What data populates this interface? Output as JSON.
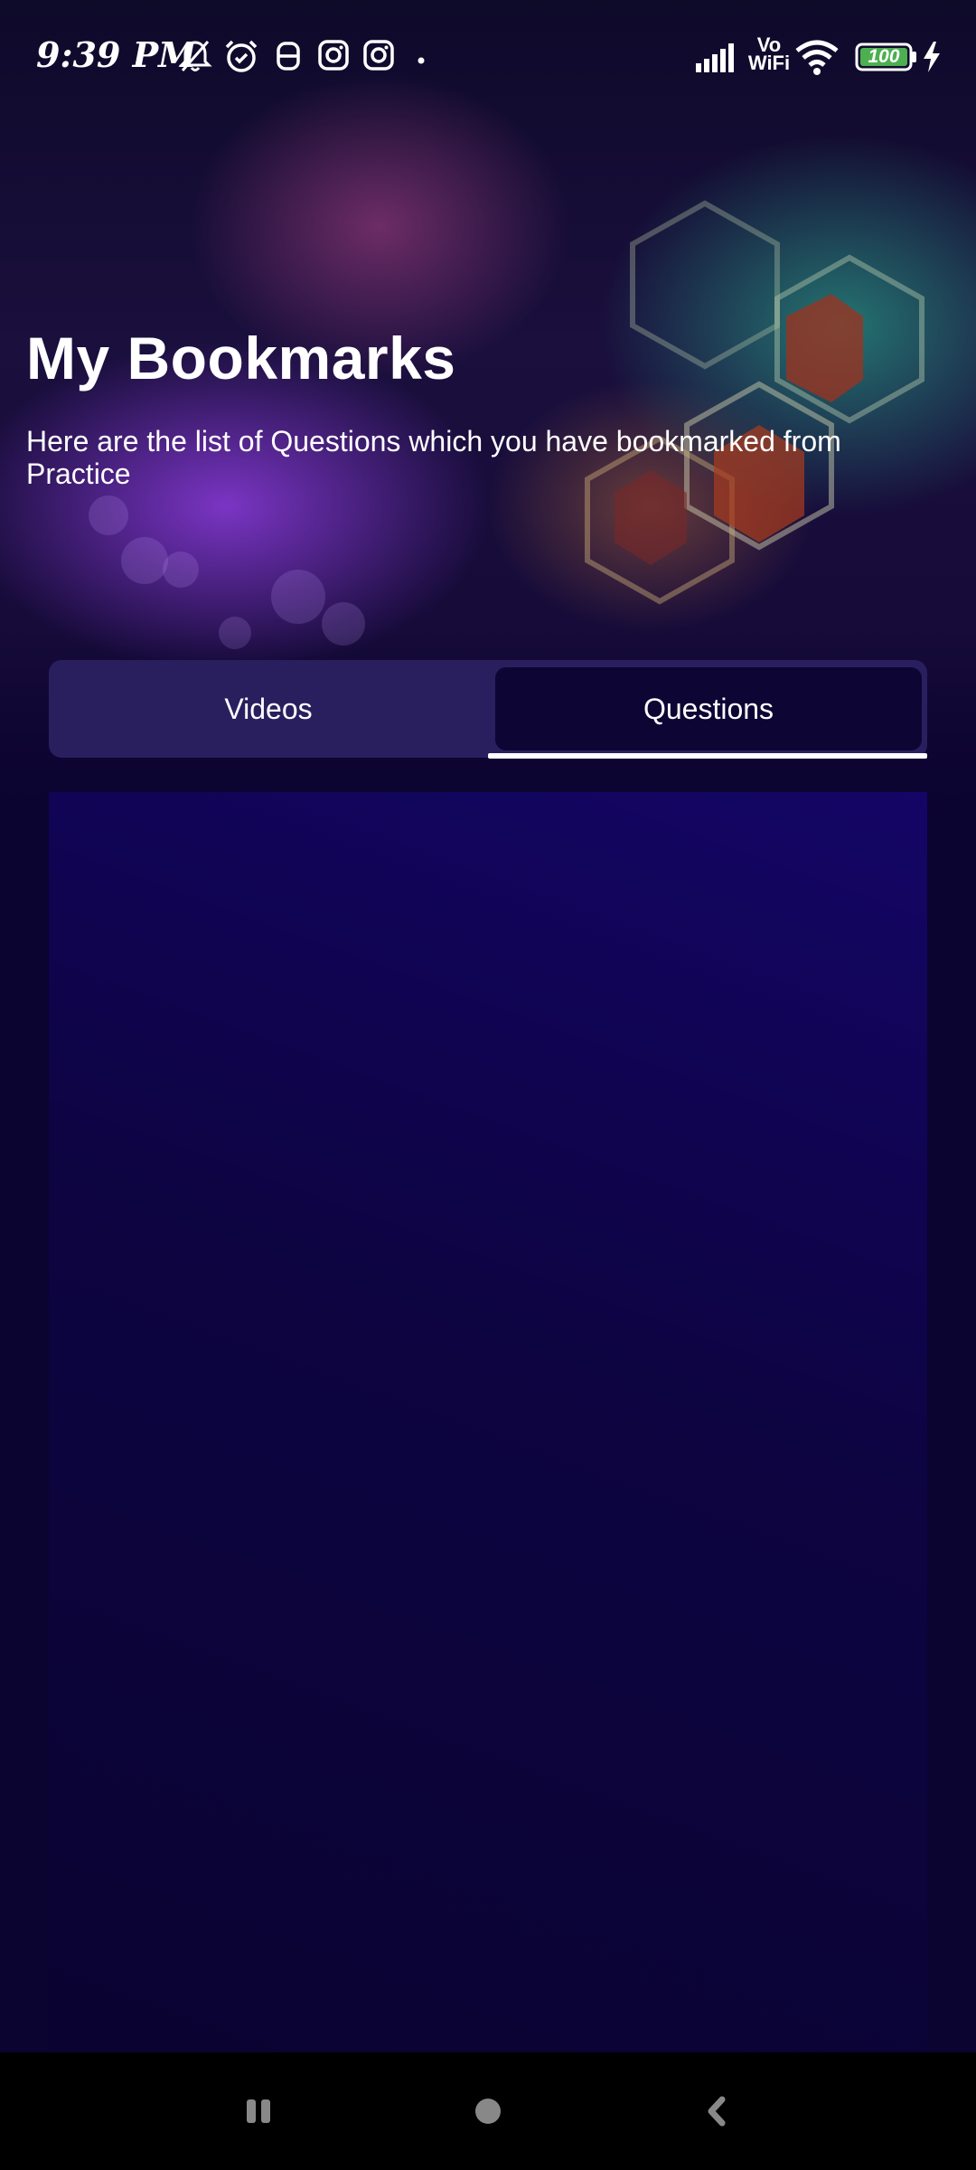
{
  "status_bar": {
    "time": "9:39 PM",
    "network_label_top": "Vo",
    "network_label_bottom": "WiFi",
    "battery_level": "100",
    "left_icons": [
      "bell-off-icon",
      "alarm-icon",
      "app-notification-icon",
      "instagram-icon",
      "instagram-icon",
      "dot-icon"
    ],
    "right_icons": [
      "signal-icon",
      "vowifi-icon",
      "wifi-icon",
      "battery-icon",
      "charging-icon"
    ]
  },
  "header": {
    "title": "My Bookmarks",
    "subtitle": "Here are the list of Questions which you have bookmarked from Practice"
  },
  "tabs": [
    {
      "label": "Videos",
      "selected": false
    },
    {
      "label": "Questions",
      "selected": true
    }
  ],
  "nav_bar": {
    "buttons": [
      "recents-icon",
      "home-icon",
      "back-icon"
    ]
  },
  "colors": {
    "background": "#0b0330",
    "tab_container": "#2a1f5e",
    "tab_selected": "#0d0533",
    "indicator": "#ffffff",
    "battery": "#4caf50"
  }
}
